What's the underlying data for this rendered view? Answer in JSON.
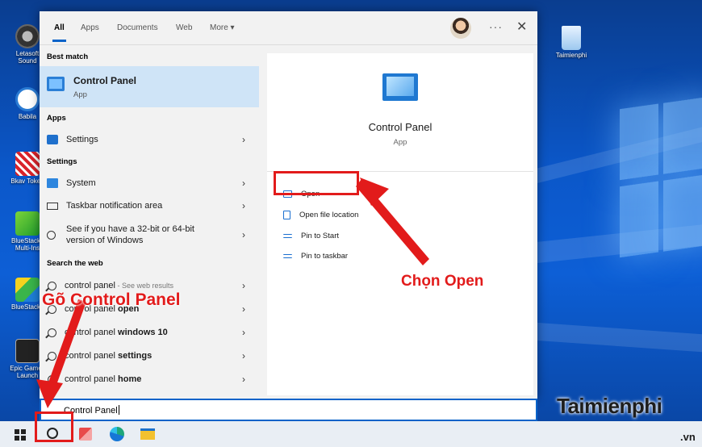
{
  "desktop": {
    "left_icons": [
      {
        "name": "speaker-icon",
        "label": "Letasoft Sound"
      },
      {
        "name": "babilala-icon",
        "label": "Babila"
      },
      {
        "name": "bkav-icon",
        "label": "Bkav Token"
      },
      {
        "name": "bluestacks-multi-icon",
        "label": "BlueStacks Multi-Ins"
      },
      {
        "name": "bluestacks-icon",
        "label": "BlueStacks"
      },
      {
        "name": "epic-games-icon",
        "label": "Epic Games Launch"
      }
    ],
    "recycle_bin": {
      "label": "Taimienphi"
    }
  },
  "tabs": {
    "all": "All",
    "apps": "Apps",
    "documents": "Documents",
    "web": "Web",
    "more": "More ▾"
  },
  "header": {
    "more_dots": "···",
    "close": "✕"
  },
  "left": {
    "best_match_header": "Best match",
    "best_match": {
      "title": "Control Panel",
      "subtitle": "App"
    },
    "apps_header": "Apps",
    "apps": [
      {
        "label": "Settings"
      }
    ],
    "settings_header": "Settings",
    "settings": [
      {
        "label": "System"
      },
      {
        "label": "Taskbar notification area"
      },
      {
        "label": "See if you have a 32-bit or 64-bit version of Windows"
      }
    ],
    "web_header": "Search the web",
    "web": [
      {
        "prefix": "control panel",
        "bold": "",
        "suffix": " - See web results"
      },
      {
        "prefix": "control panel ",
        "bold": "open",
        "suffix": ""
      },
      {
        "prefix": "control panel ",
        "bold": "windows 10",
        "suffix": ""
      },
      {
        "prefix": "control panel ",
        "bold": "settings",
        "suffix": ""
      },
      {
        "prefix": "control panel ",
        "bold": "home",
        "suffix": ""
      }
    ],
    "chevron": "›"
  },
  "right": {
    "title": "Control Panel",
    "subtitle": "App",
    "actions": [
      {
        "label": "Open"
      },
      {
        "label": "Open file location"
      },
      {
        "label": "Pin to Start"
      },
      {
        "label": "Pin to taskbar"
      }
    ]
  },
  "search": {
    "value": "Control Panel"
  },
  "annotations": {
    "type_label": "Gõ Control Panel",
    "open_label": "Chọn Open",
    "watermark": "Taimienphi",
    "watermark_suffix": ".vn"
  },
  "colors": {
    "accent": "#0a63c9",
    "annotation": "#e21b1b",
    "best_match_bg": "#cfe4f7"
  }
}
